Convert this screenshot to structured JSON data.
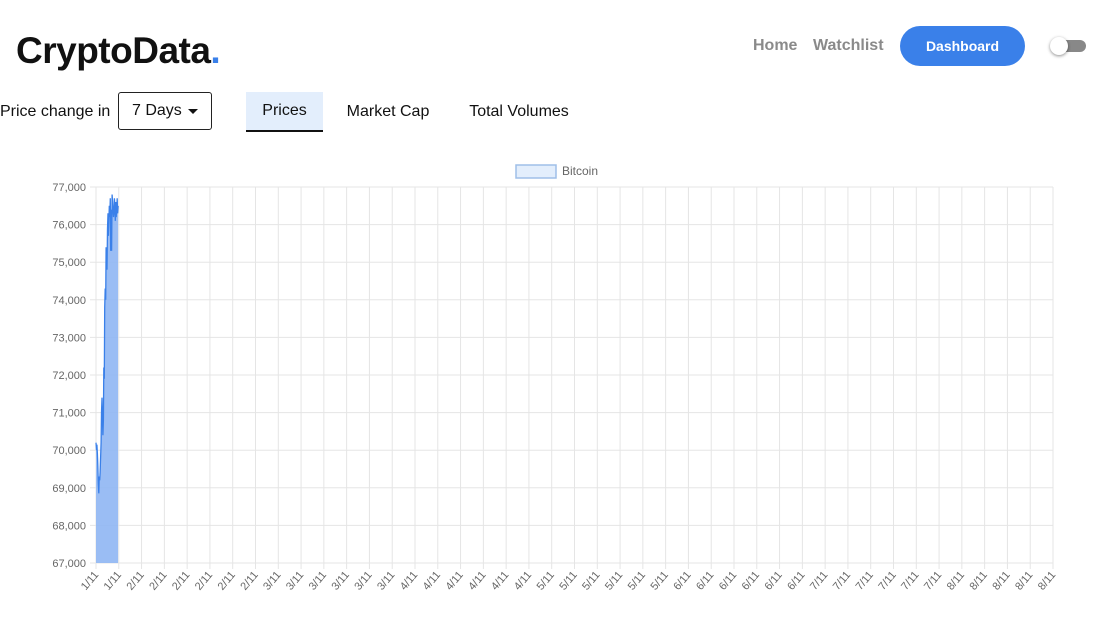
{
  "header": {
    "logo_text": "CryptoData",
    "logo_dot": ".",
    "nav": {
      "home": "Home",
      "watchlist": "Watchlist",
      "dashboard": "Dashboard"
    },
    "theme_toggle": {
      "on": false
    }
  },
  "controls": {
    "price_change_label": "Price change in",
    "period_selected": "7 Days",
    "tabs": [
      {
        "label": "Prices",
        "active": true
      },
      {
        "label": "Market Cap",
        "active": false
      },
      {
        "label": "Total Volumes",
        "active": false
      }
    ]
  },
  "colors": {
    "accent": "#3a80e9",
    "fill": "#8fb6f3",
    "grid": "#e5e5e5"
  },
  "chart_data": {
    "type": "line",
    "series": [
      {
        "name": "Bitcoin",
        "x_index": [
          0,
          0.5,
          1,
          1.5,
          2,
          2.5,
          3,
          3.5,
          4,
          4.5,
          5,
          5.5,
          6,
          6.5,
          7,
          7.5,
          8,
          8.5,
          9,
          9.5,
          10,
          10.5,
          11,
          11.5,
          12,
          12.5,
          13,
          13.5,
          14,
          14.5,
          15,
          15.5,
          16,
          16.5,
          17,
          17.5,
          18,
          18.5,
          19,
          19.5,
          20,
          20.5,
          21,
          21.5,
          22,
          22.5,
          23,
          23.5,
          24
        ],
        "values": [
          70200,
          70000,
          70150,
          69900,
          69600,
          69100,
          68850,
          69300,
          69200,
          69400,
          69800,
          70200,
          71000,
          71400,
          70900,
          70400,
          70800,
          72200,
          71900,
          73800,
          74300,
          74000,
          75400,
          75200,
          74800,
          75900,
          76300,
          75700,
          76100,
          76500,
          76200,
          76700,
          75300,
          76400,
          75300,
          76800,
          76600,
          76400,
          76200,
          76300,
          76700,
          76500,
          76100,
          76600,
          76200,
          76400,
          76700,
          76300,
          76500
        ],
        "fill": true
      }
    ],
    "x_tick_labels": [
      "1/11",
      "1/11",
      "2/11",
      "2/11",
      "2/11",
      "2/11",
      "2/11",
      "2/11",
      "3/11",
      "3/11",
      "3/11",
      "3/11",
      "3/11",
      "3/11",
      "4/11",
      "4/11",
      "4/11",
      "4/11",
      "4/11",
      "4/11",
      "5/11",
      "5/11",
      "5/11",
      "5/11",
      "5/11",
      "5/11",
      "6/11",
      "6/11",
      "6/11",
      "6/11",
      "6/11",
      "6/11",
      "7/11",
      "7/11",
      "7/11",
      "7/11",
      "7/11",
      "7/11",
      "8/11",
      "8/11",
      "8/11",
      "8/11",
      "8/11"
    ],
    "ylim": [
      67000,
      77000
    ],
    "y_ticks": [
      "67,000",
      "68,000",
      "69,000",
      "70,000",
      "71,000",
      "72,000",
      "73,000",
      "74,000",
      "75,000",
      "76,000",
      "77,000"
    ],
    "grid": true,
    "legend": "top"
  }
}
